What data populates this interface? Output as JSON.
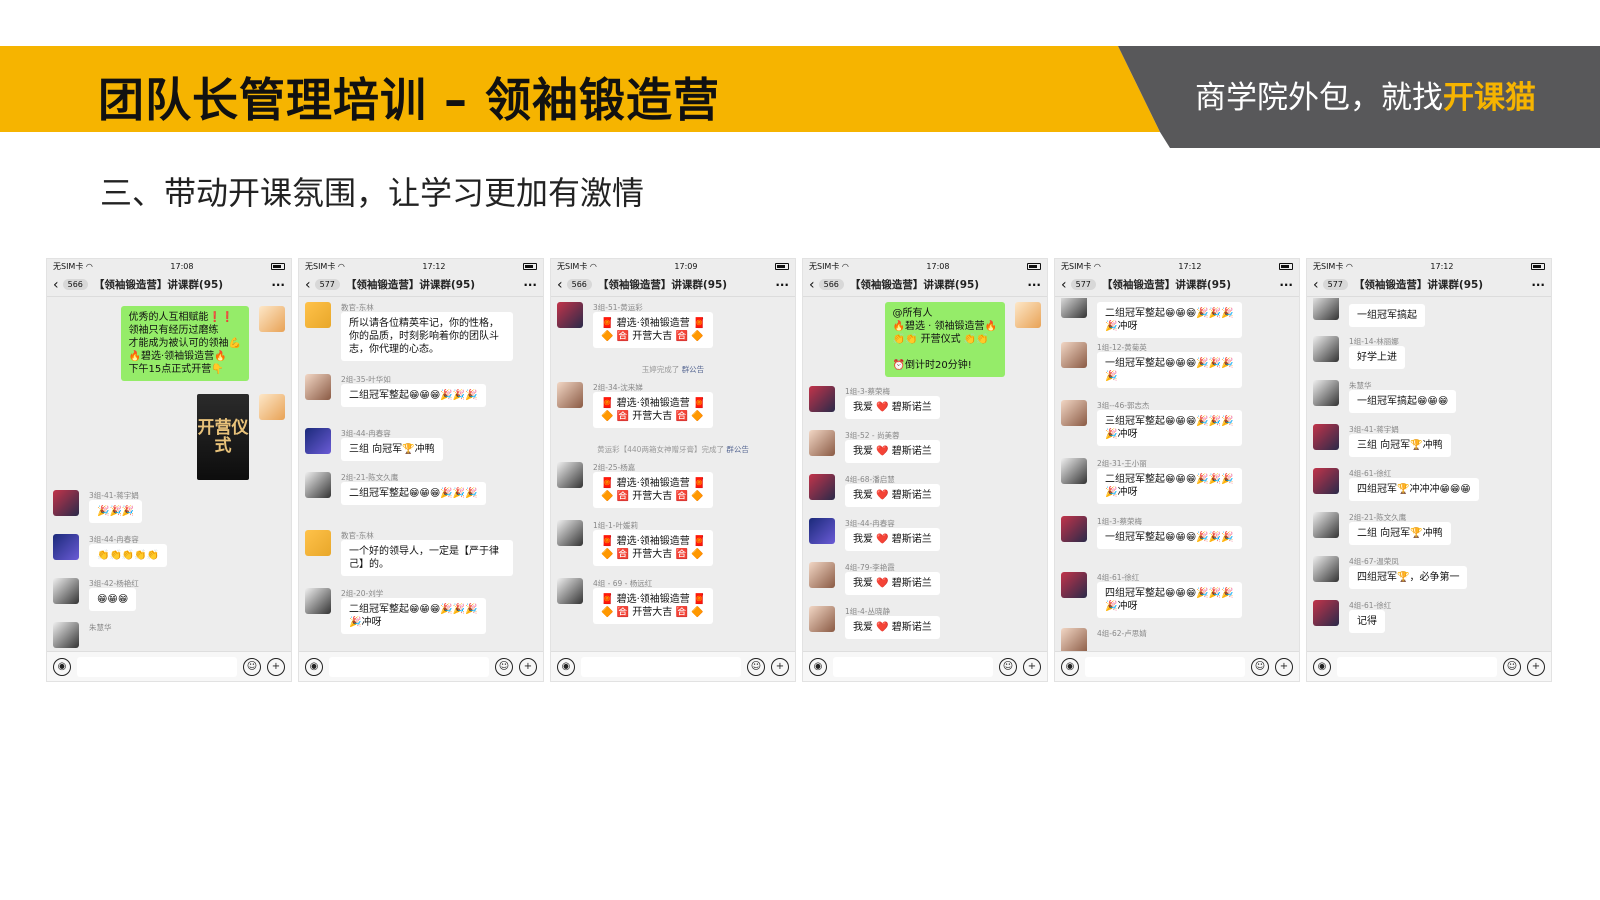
{
  "slide": {
    "title": "团队长管理培训 – 领袖锻造营",
    "slogan_prefix": "商学院外包，就找",
    "slogan_brand": "开课猫",
    "section_heading": "三、带动开课氛围，让学习更加有激情",
    "colors": {
      "banner": "#f6b400",
      "banner_dark": "#58585a"
    }
  },
  "phones": [
    {
      "carrier": "无SIM卡",
      "time": "17:08",
      "back_count": "566",
      "group_title": "【领袖锻造营】讲课群(95)",
      "messages": [
        {
          "text": "优秀的人互相赋能❗❗\n领袖只有经历过磨练\n才能成为被认可的领袖💪\n🔥碧选·领袖锻造营🔥\n下午15点正式开营👇"
        },
        {
          "text": "开营仪式"
        },
        {
          "sender": "3组-41-蒋宇娟",
          "text": "🎉🎉🎉"
        },
        {
          "sender": "3组-44-冉春容",
          "text": "👏👏👏👏👏"
        },
        {
          "sender": "3组-42-杨艳红",
          "text": "😁😁😁"
        },
        {
          "sender": "朱慧华",
          "text": ""
        }
      ]
    },
    {
      "carrier": "无SIM卡",
      "time": "17:12",
      "back_count": "577",
      "group_title": "【领袖锻造营】讲课群(95)",
      "messages": [
        {
          "sender": "教官-东林",
          "text": "所以请各位精英牢记，你的性格，你的品质，时刻影响着你的团队斗志，你代理的心态。"
        },
        {
          "sender": "2组-35-叶华如",
          "text": "二组冠军整起😁😁😁🎉🎉🎉"
        },
        {
          "sender": "3组-44-冉春容",
          "text": "三组 向冠军🏆冲鸭"
        },
        {
          "sender": "2组-21-陈文久鹰",
          "text": "二组冠军整起😁😁😁🎉🎉🎉"
        },
        {
          "sender": "教官-东林",
          "text": "一个好的领导人，一定是【严于律己】的。"
        },
        {
          "sender": "2组-20-刘学",
          "text": "二组冠军整起😁😁😁🎉🎉🎉\n🎉冲呀"
        }
      ]
    },
    {
      "carrier": "无SIM卡",
      "time": "17:09",
      "back_count": "566",
      "group_title": "【领袖锻造营】讲课群(95)",
      "messages": [
        {
          "sender": "3组-51-黄运彩",
          "text": "🧧 碧选·领袖锻造营 🧧\n🔶 🈴 开营大吉 🈴 🔶"
        },
        {
          "sys": "玉婷完成了",
          "link": "群公告"
        },
        {
          "sender": "2组-34-沈来娣",
          "text": "🧧 碧选·领袖锻造营 🧧\n🔶 🈴 开营大吉 🈴 🔶"
        },
        {
          "sys": "黄运彩【440两箱女神赠牙膏】完成了",
          "link": "群公告"
        },
        {
          "sender": "2组-25-杨嘉",
          "text": "🧧 碧选·领袖锻造营 🧧\n🔶 🈴 开营大吉 🈴 🔶"
        },
        {
          "sender": "1组-1-叶媛莉",
          "text": "🧧 碧选·领袖锻造营 🧧\n🔶 🈴 开营大吉 🈴 🔶"
        },
        {
          "sender": "4组 - 69 - 杨远红",
          "text": "🧧 碧选·领袖锻造营 🧧\n🔶 🈴 开营大吉 🈴 🔶"
        }
      ]
    },
    {
      "carrier": "无SIM卡",
      "time": "17:08",
      "back_count": "566",
      "group_title": "【领袖锻造营】讲课群(95)",
      "messages": [
        {
          "text": "@所有人\n🔥碧选 · 领袖锻造营🔥\n👏👏 开营仪式 👏👏\n\n⏰倒计时20分钟!"
        },
        {
          "sender": "1组-3-蔡荣梅",
          "text": "我爱 ❤️ 碧斯诺兰"
        },
        {
          "sender": "3组-52 - 尚美蓉",
          "text": "我爱 ❤️ 碧斯诺兰"
        },
        {
          "sender": "4组-68-潘启慧",
          "text": "我爱 ❤️ 碧斯诺兰"
        },
        {
          "sender": "3组-44-冉春容",
          "text": "我爱 ❤️ 碧斯诺兰"
        },
        {
          "sender": "4组-79-李艳霞",
          "text": "我爱 ❤️ 碧斯诺兰"
        },
        {
          "sender": "1组-4-丛晓静",
          "text": "我爱 ❤️ 碧斯诺兰"
        }
      ]
    },
    {
      "carrier": "无SIM卡",
      "time": "17:12",
      "back_count": "577",
      "group_title": "【领袖锻造营】讲课群(95)",
      "messages": [
        {
          "sender": "",
          "text": "二组冠军整起😁😁😁🎉🎉🎉\n🎉冲呀"
        },
        {
          "sender": "1组-12-黄菊英",
          "text": "一组冠军整起😁😁😁🎉🎉🎉\n🎉"
        },
        {
          "sender": "3组--46-郭志杰",
          "text": "三组冠军整起😁😁😁🎉🎉🎉\n🎉冲呀"
        },
        {
          "sender": "2组-31-王小丽",
          "text": "二组冠军整起😁😁😁🎉🎉🎉\n🎉冲呀"
        },
        {
          "sender": "1组-3-蔡荣梅",
          "text": "一组冠军整起😁😁😁🎉🎉🎉"
        },
        {
          "sender": "4组-61-徐红",
          "text": "四组冠军整起😁😁😁🎉🎉🎉\n🎉冲呀"
        },
        {
          "sender": "4组-62-卢思婧",
          "text": ""
        }
      ]
    },
    {
      "carrier": "无SIM卡",
      "time": "17:12",
      "back_count": "577",
      "group_title": "【领袖锻造营】讲课群(95)",
      "messages": [
        {
          "sender": "",
          "text": "一组冠军搞起"
        },
        {
          "sender": "1组-14-林丽娜",
          "text": "好学上进"
        },
        {
          "sender": "朱慧华",
          "text": "一组冠军搞起😁😁😁"
        },
        {
          "sender": "3组-41-蒋宇娟",
          "text": "三组 向冠军🏆冲鸭"
        },
        {
          "sender": "4组-61-徐红",
          "text": "四组冠军🏆冲冲冲😁😁😁"
        },
        {
          "sender": "2组-21-陈文久鹰",
          "text": "二组 向冠军🏆冲鸭"
        },
        {
          "sender": "4组-67-温荣凤",
          "text": "四组冠军🏆，必争第一"
        },
        {
          "sender": "4组-61-徐红",
          "text": "记得"
        }
      ]
    }
  ],
  "icons": [
    "back-chevron-icon",
    "more-icon",
    "voice-icon",
    "emoji-icon",
    "plus-icon"
  ]
}
